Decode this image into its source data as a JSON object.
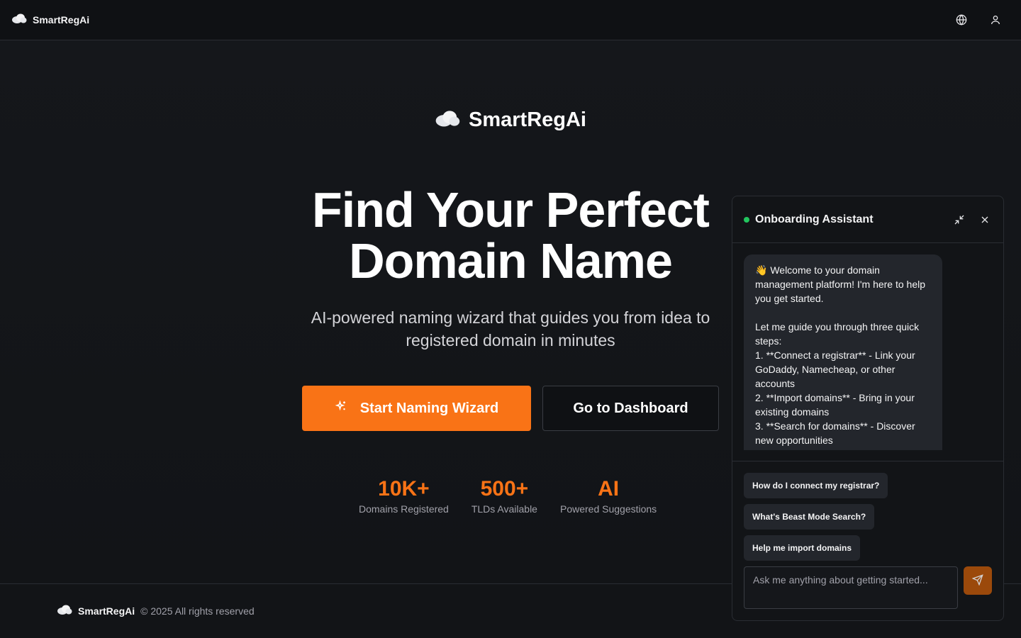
{
  "header": {
    "brand_name": "SmartRegAi",
    "icons": [
      "cloud-icon",
      "globe-icon",
      "user-icon"
    ]
  },
  "hero": {
    "logo_text": "SmartRegAi",
    "headline_line1": "Find Your Perfect",
    "headline_line2": "Domain Name",
    "subhead_line1": "AI-powered naming wizard that guides you from idea to",
    "subhead_line2": "registered domain in minutes",
    "primary_cta": "Start Naming Wizard",
    "secondary_cta": "Go to Dashboard"
  },
  "stats": [
    {
      "value": "10K+",
      "label": "Domains Registered"
    },
    {
      "value": "500+",
      "label": "TLDs Available"
    },
    {
      "value": "AI",
      "label": "Powered Suggestions"
    }
  ],
  "footer": {
    "brand_name": "SmartRegAi",
    "copyright": "© 2025 All rights reserved"
  },
  "chat": {
    "title": "Onboarding Assistant",
    "message": "👋 Welcome to your domain management platform! I'm here to help you get started.\n\nLet me guide you through three quick steps:\n1. **Connect a registrar** - Link your GoDaddy, Namecheap, or other accounts\n2. **Import domains** - Bring in your existing domains\n3. **Search for domains** - Discover new opportunities",
    "suggestions": [
      "How do I connect my registrar?",
      "What's Beast Mode Search?",
      "Help me import domains"
    ],
    "input_placeholder": "Ask me anything about getting started...",
    "input_value": ""
  },
  "colors": {
    "accent": "#f97316",
    "status_online": "#22c55e",
    "background": "#121417"
  }
}
